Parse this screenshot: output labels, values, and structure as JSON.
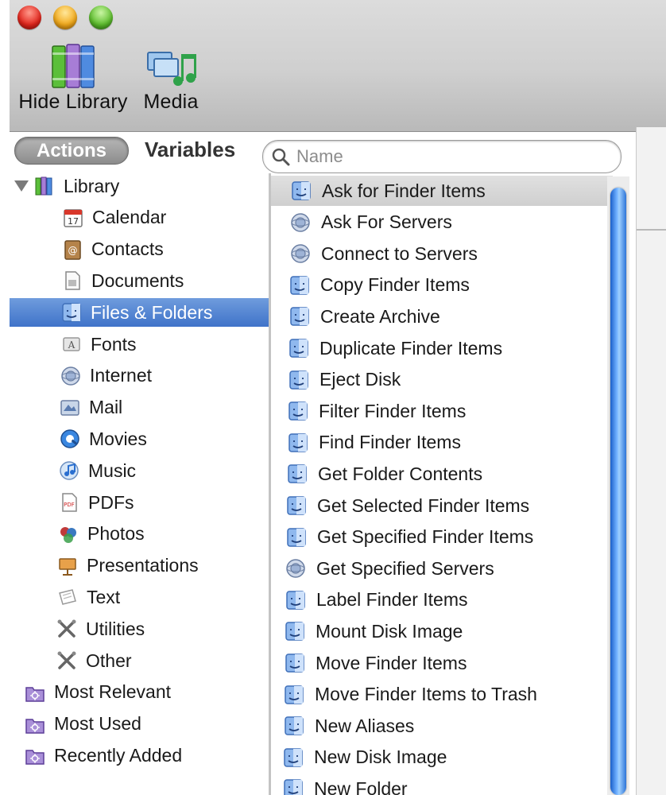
{
  "toolbar": {
    "hide_library_label": "Hide Library",
    "media_label": "Media"
  },
  "tabs": {
    "actions": "Actions",
    "variables": "Variables"
  },
  "search": {
    "placeholder": "Name",
    "value": ""
  },
  "library": {
    "root": "Library",
    "items": [
      {
        "label": "Calendar",
        "icon": "calendar-icon"
      },
      {
        "label": "Contacts",
        "icon": "contacts-icon"
      },
      {
        "label": "Documents",
        "icon": "documents-icon"
      },
      {
        "label": "Files & Folders",
        "icon": "finder-icon",
        "selected": true
      },
      {
        "label": "Fonts",
        "icon": "fonts-icon"
      },
      {
        "label": "Internet",
        "icon": "internet-icon"
      },
      {
        "label": "Mail",
        "icon": "mail-icon"
      },
      {
        "label": "Movies",
        "icon": "movies-icon"
      },
      {
        "label": "Music",
        "icon": "music-icon"
      },
      {
        "label": "PDFs",
        "icon": "pdf-icon"
      },
      {
        "label": "Photos",
        "icon": "photos-icon"
      },
      {
        "label": "Presentations",
        "icon": "presentations-icon"
      },
      {
        "label": "Text",
        "icon": "text-icon"
      },
      {
        "label": "Utilities",
        "icon": "utilities-icon"
      },
      {
        "label": "Other",
        "icon": "other-icon"
      }
    ],
    "smart_groups": [
      {
        "label": "Most Relevant",
        "icon": "smart-folder-icon"
      },
      {
        "label": "Most Used",
        "icon": "smart-folder-icon"
      },
      {
        "label": "Recently Added",
        "icon": "smart-folder-icon"
      }
    ]
  },
  "actions": [
    {
      "label": "Ask for Finder Items",
      "icon": "finder-icon",
      "selected": true
    },
    {
      "label": "Ask For Servers",
      "icon": "network-icon"
    },
    {
      "label": "Connect to Servers",
      "icon": "network-icon"
    },
    {
      "label": "Copy Finder Items",
      "icon": "finder-icon"
    },
    {
      "label": "Create Archive",
      "icon": "finder-icon"
    },
    {
      "label": "Duplicate Finder Items",
      "icon": "finder-icon"
    },
    {
      "label": "Eject Disk",
      "icon": "finder-icon"
    },
    {
      "label": "Filter Finder Items",
      "icon": "finder-icon"
    },
    {
      "label": "Find Finder Items",
      "icon": "finder-icon"
    },
    {
      "label": "Get Folder Contents",
      "icon": "finder-icon"
    },
    {
      "label": "Get Selected Finder Items",
      "icon": "finder-icon"
    },
    {
      "label": "Get Specified Finder Items",
      "icon": "finder-icon"
    },
    {
      "label": "Get Specified Servers",
      "icon": "network-icon"
    },
    {
      "label": "Label Finder Items",
      "icon": "finder-icon"
    },
    {
      "label": "Mount Disk Image",
      "icon": "finder-icon"
    },
    {
      "label": "Move Finder Items",
      "icon": "finder-icon"
    },
    {
      "label": "Move Finder Items to Trash",
      "icon": "finder-icon"
    },
    {
      "label": "New Aliases",
      "icon": "finder-icon"
    },
    {
      "label": "New Disk Image",
      "icon": "finder-icon"
    },
    {
      "label": "New Folder",
      "icon": "finder-icon"
    }
  ],
  "colors": {
    "selection_blue": "#3f73c9",
    "scroll_thumb": "#2d74d8"
  }
}
